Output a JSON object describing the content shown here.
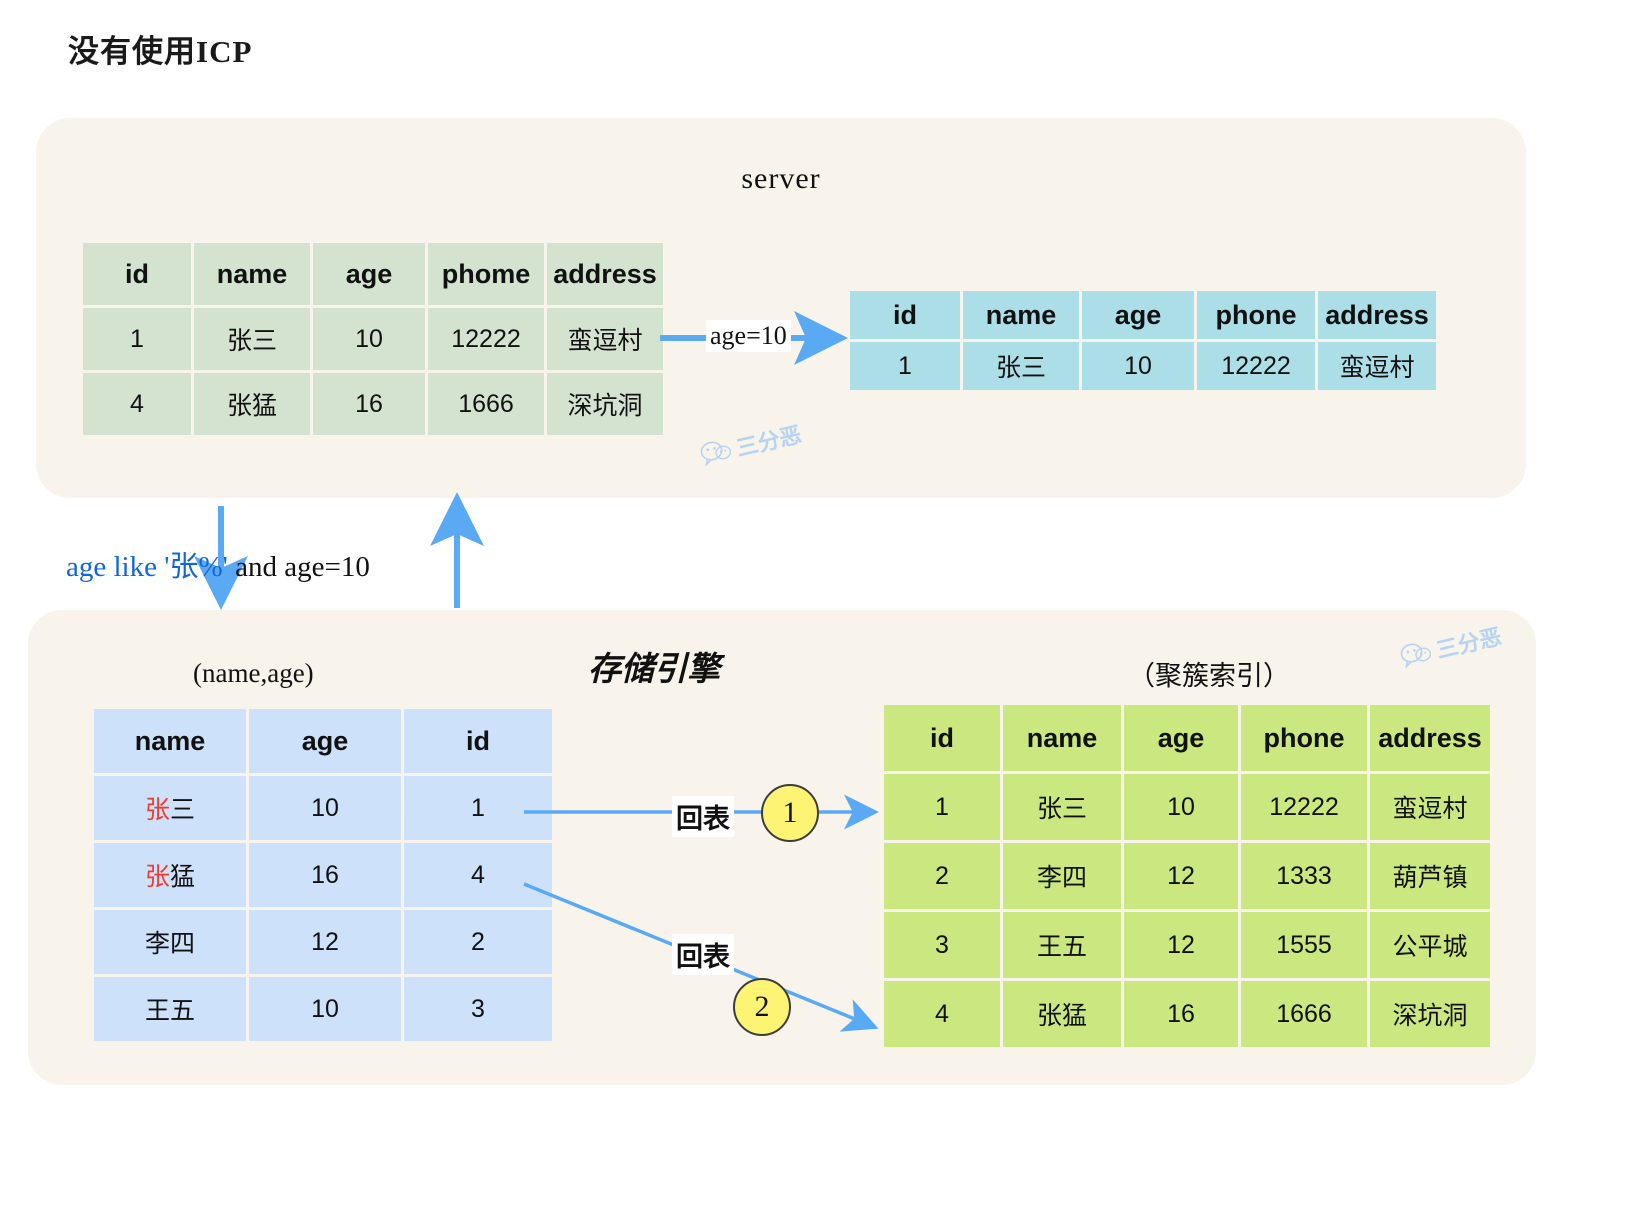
{
  "page": {
    "title": "没有使用ICP",
    "watermark": "三分恶",
    "watermark_icon": "wechat-icon"
  },
  "server_panel": {
    "title": "server",
    "table": {
      "name": "server-table",
      "headers": [
        "id",
        "name",
        "age",
        "phome",
        "address"
      ],
      "rows": [
        [
          "1",
          "张三",
          "10",
          "12222",
          "蛮逗村"
        ],
        [
          "4",
          "张猛",
          "16",
          "1666",
          "深坑洞"
        ]
      ]
    },
    "filter_label": "age=10",
    "result_table": {
      "name": "result-table",
      "headers": [
        "id",
        "name",
        "age",
        "phone",
        "address"
      ],
      "rows": [
        [
          "1",
          "张三",
          "10",
          "12222",
          "蛮逗村"
        ]
      ]
    }
  },
  "query": {
    "condition_blue": "age like '张%'",
    "condition_black": " and age=10"
  },
  "engine_panel": {
    "title": "存储引擎",
    "index_caption": "(name,age)",
    "clustered_caption": "（聚簇索引）",
    "index_table": {
      "name": "secondary-index-table",
      "headers": [
        "name",
        "age",
        "id"
      ],
      "rows": [
        {
          "name_hl": "张",
          "name_rest": "三",
          "age": "10",
          "id": "1",
          "id_hl": true
        },
        {
          "name_hl": "张",
          "name_rest": "猛",
          "age": "16",
          "id": "4",
          "id_hl": true
        },
        {
          "name_hl": "",
          "name_rest": "李四",
          "age": "12",
          "id": "2",
          "id_hl": false
        },
        {
          "name_hl": "",
          "name_rest": "王五",
          "age": "10",
          "id": "3",
          "id_hl": false
        }
      ]
    },
    "clustered_table": {
      "name": "clustered-index-table",
      "headers": [
        "id",
        "name",
        "age",
        "phone",
        "address"
      ],
      "rows": [
        {
          "id": "1",
          "id_hl": true,
          "name": "张三",
          "age": "10",
          "phone": "12222",
          "address": "蛮逗村"
        },
        {
          "id": "2",
          "id_hl": false,
          "name": "李四",
          "age": "12",
          "phone": "1333",
          "address": "葫芦镇"
        },
        {
          "id": "3",
          "id_hl": false,
          "name": "王五",
          "age": "12",
          "phone": "1555",
          "address": "公平城"
        },
        {
          "id": "4",
          "id_hl": true,
          "name": "张猛",
          "age": "16",
          "phone": "1666",
          "address": "深坑洞"
        }
      ]
    },
    "lookup_label_1": "回表",
    "lookup_label_2": "回表",
    "step_1": "1",
    "step_2": "2"
  },
  "colors": {
    "panel_bg": "#f8f4ec",
    "server_table": "#d4e3d0",
    "result_table": "#abdee6",
    "index_table": "#cde1fb",
    "clustered_table": "#cae87f",
    "highlight": "#f03c2e",
    "arrow": "#5aa9f5",
    "badge": "#fdf474",
    "query_blue": "#1366d6"
  }
}
